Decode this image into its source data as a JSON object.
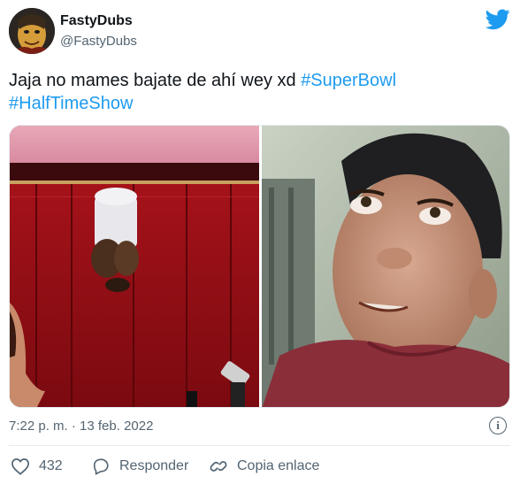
{
  "tweet": {
    "author_name": "FastyDubs",
    "author_handle": "@FastyDubs",
    "text_plain": "Jaja no mames bajate de ahí wey xd ",
    "hashtags": [
      "#SuperBowl",
      "#HalfTimeShow"
    ],
    "timestamp": "7:22 p. m. · 13 feb. 2022",
    "info_symbol": "i"
  },
  "actions": {
    "like_count": "432",
    "reply_label": "Responder",
    "copy_label": "Copia enlace"
  },
  "icons": {
    "logo": "twitter-bird-icon",
    "info": "info-icon",
    "like": "heart-icon",
    "reply": "reply-icon",
    "copy": "link-icon"
  },
  "colors": {
    "accent": "#1d9bf0",
    "text": "#0f1419",
    "muted": "#536471",
    "divider": "#e6ecf0"
  }
}
